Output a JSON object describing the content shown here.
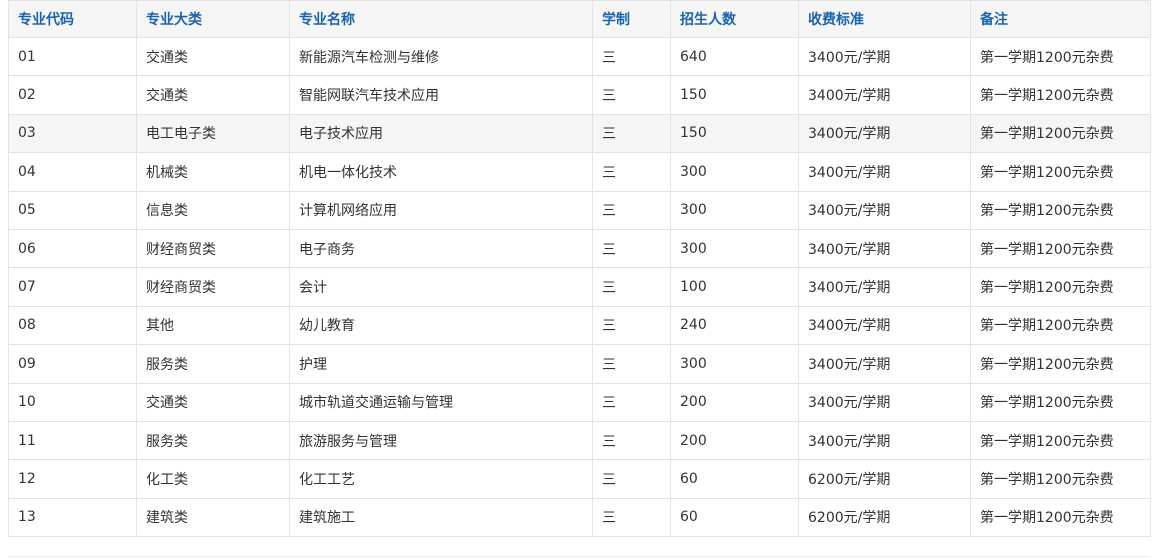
{
  "table": {
    "headers": [
      "专业代码",
      "专业大类",
      "专业名称",
      "学制",
      "招生人数",
      "收费标准",
      "备注"
    ],
    "rows": [
      [
        "01",
        "交通类",
        "新能源汽车检测与维修",
        "三",
        "640",
        "3400元/学期",
        "第一学期1200元杂费"
      ],
      [
        "02",
        "交通类",
        "智能网联汽车技术应用",
        "三",
        "150",
        "3400元/学期",
        "第一学期1200元杂费"
      ],
      [
        "03",
        "电工电子类",
        "电子技术应用",
        "三",
        "150",
        "3400元/学期",
        "第一学期1200元杂费"
      ],
      [
        "04",
        "机械类",
        "机电一体化技术",
        "三",
        "300",
        "3400元/学期",
        "第一学期1200元杂费"
      ],
      [
        "05",
        "信息类",
        "计算机网络应用",
        "三",
        "300",
        "3400元/学期",
        "第一学期1200元杂费"
      ],
      [
        "06",
        "财经商贸类",
        "电子商务",
        "三",
        "300",
        "3400元/学期",
        "第一学期1200元杂费"
      ],
      [
        "07",
        "财经商贸类",
        "会计",
        "三",
        "100",
        "3400元/学期",
        "第一学期1200元杂费"
      ],
      [
        "08",
        "其他",
        "幼儿教育",
        "三",
        "240",
        "3400元/学期",
        "第一学期1200元杂费"
      ],
      [
        "09",
        "服务类",
        "护理",
        "三",
        "300",
        "3400元/学期",
        "第一学期1200元杂费"
      ],
      [
        "10",
        "交通类",
        "城市轨道交通运输与管理",
        "三",
        "200",
        "3400元/学期",
        "第一学期1200元杂费"
      ],
      [
        "11",
        "服务类",
        "旅游服务与管理",
        "三",
        "200",
        "3400元/学期",
        "第一学期1200元杂费"
      ],
      [
        "12",
        "化工类",
        "化工工艺",
        "三",
        "60",
        "6200元/学期",
        "第一学期1200元杂费"
      ],
      [
        "13",
        "建筑类",
        "建筑施工",
        "三",
        "60",
        "6200元/学期",
        "第一学期1200元杂费"
      ]
    ]
  },
  "colors": {
    "header_text": "#1a63b0",
    "header_bg": "#f5f5f5",
    "highlight_row_bg": "#f5f5f5",
    "border": "#e3e3e3",
    "cell_text": "#333333"
  }
}
